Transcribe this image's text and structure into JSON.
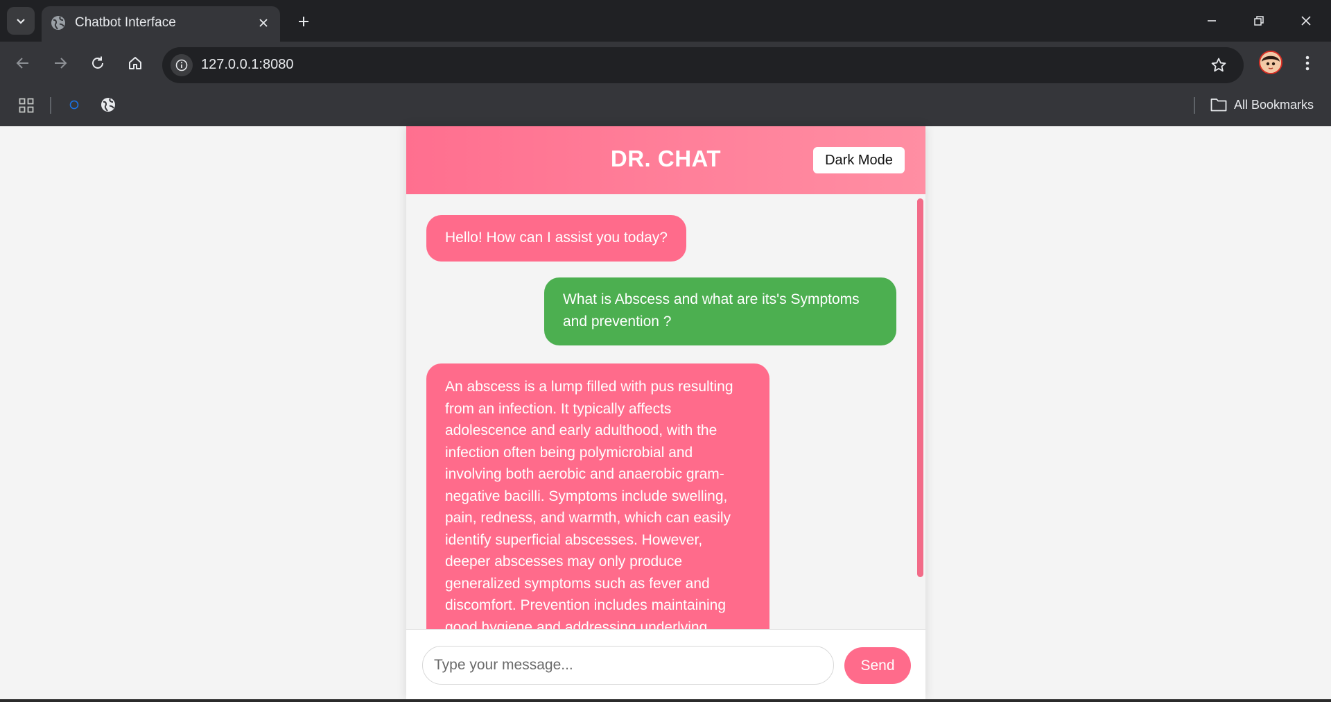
{
  "browser": {
    "tab_title": "Chatbot Interface",
    "url": "127.0.0.1:8080",
    "bookmarks_label": "All Bookmarks"
  },
  "chat": {
    "title": "DR. CHAT",
    "dark_mode_label": "Dark Mode",
    "messages": [
      {
        "sender": "bot",
        "text": "Hello! How can I assist you today?"
      },
      {
        "sender": "user",
        "text": "What is Abscess and what are its's Symptoms and prevention ?"
      },
      {
        "sender": "bot",
        "text": "An abscess is a lump filled with pus resulting from an infection. It typically affects adolescence and early adulthood, with the infection often being polymicrobial and involving both aerobic and anaerobic gram-negative bacilli. Symptoms include swelling, pain, redness, and warmth, which can easily identify superficial abscesses. However, deeper abscesses may only produce generalized symptoms such as fever and discomfort. Prevention includes maintaining good hygiene and addressing underlying conditions that may increase susceptibility to"
      }
    ],
    "input_placeholder": "Type your message...",
    "send_label": "Send"
  },
  "colors": {
    "header": "#ff6f8f",
    "bot_bubble": "#ff6b8b",
    "user_bubble": "#4caf50",
    "send_button": "#ff6b8b"
  }
}
